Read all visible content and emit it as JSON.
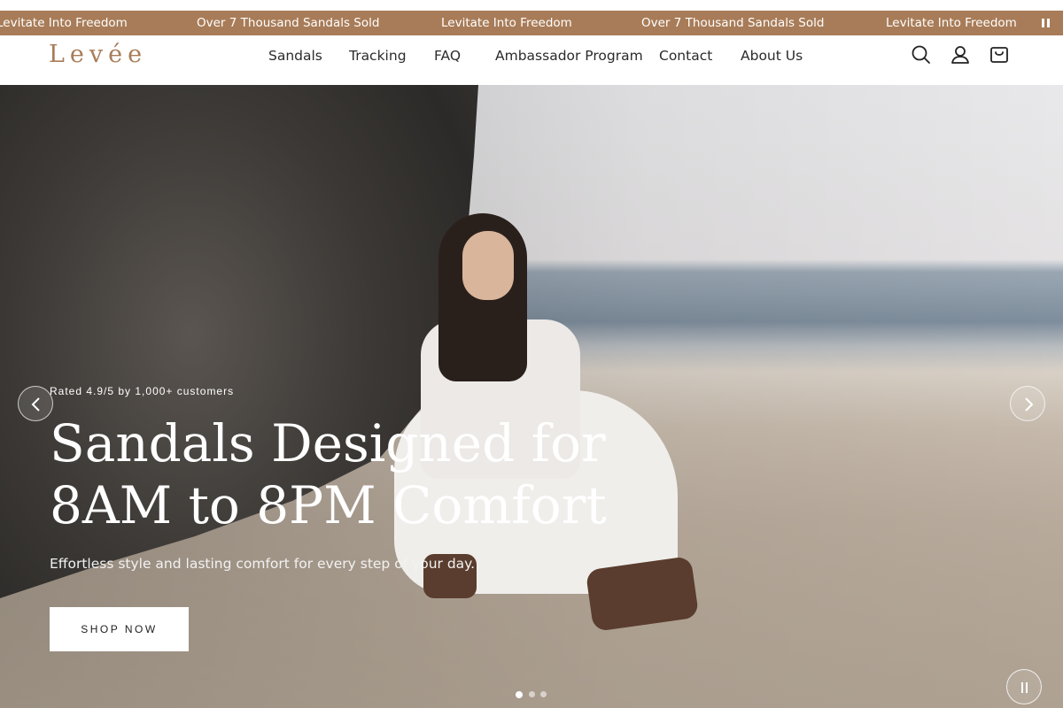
{
  "announcement": {
    "items": [
      "Levitate Into Freedom",
      "Over 7 Thousand Sandals Sold",
      "Levitate Into Freedom",
      "Over 7 Thousand Sandals Sold",
      "Levitate Into Freedom"
    ],
    "pause_icon": "pause-icon",
    "background_color": "#a87c58"
  },
  "header": {
    "logo": "Levée",
    "nav": [
      "Sandals",
      "Tracking",
      "FAQ",
      "Ambassador Program",
      "Contact",
      "About Us"
    ],
    "icons": [
      "search-icon",
      "account-icon",
      "cart-icon"
    ]
  },
  "hero": {
    "rating": "Rated 4.9/5 by 1,000+ customers",
    "headline_line1": "Sandals Designed for",
    "headline_line2": "8AM to 8PM Comfort",
    "subtext": "Effortless style and lasting comfort for every step of your day.",
    "cta": "SHOP NOW",
    "slides_total": 3,
    "active_slide": 1,
    "controls": [
      "chevron-left-icon",
      "chevron-right-icon",
      "pause-icon"
    ]
  }
}
